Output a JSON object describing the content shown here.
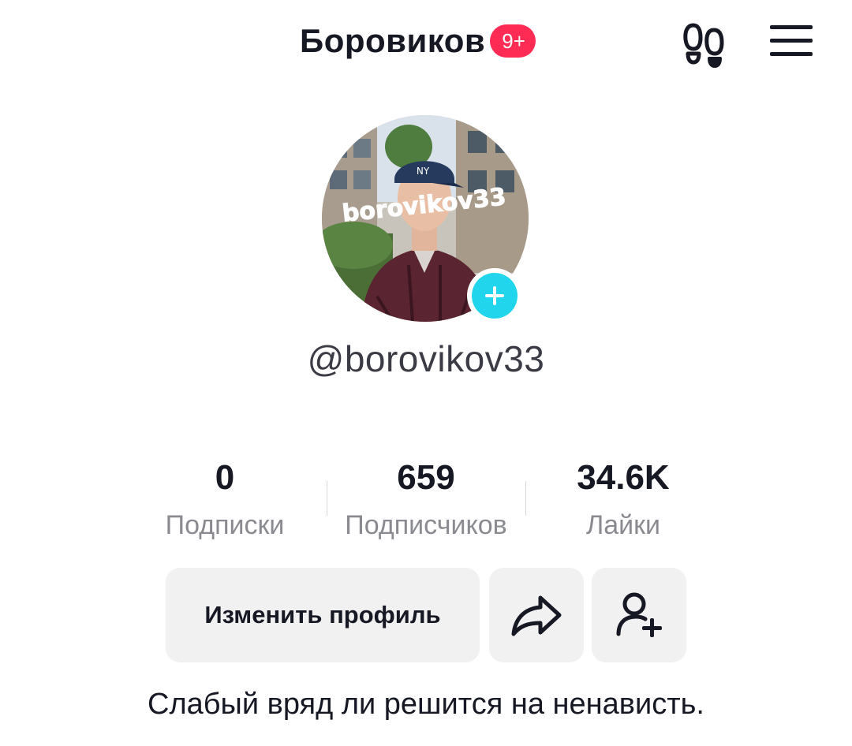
{
  "header": {
    "title": "Боровиков",
    "notification_badge": "9+",
    "footprints_icon": "footprints-icon",
    "menu_icon": "hamburger-menu-icon"
  },
  "profile": {
    "avatar_overlay_text": "borovikov33",
    "add_avatar_icon": "plus-icon",
    "username": "@borovikov33",
    "bio": "Слабый вряд ли решится на ненависть."
  },
  "stats": [
    {
      "value": "0",
      "label": "Подписки"
    },
    {
      "value": "659",
      "label": "Подписчиков"
    },
    {
      "value": "34.6K",
      "label": "Лайки"
    }
  ],
  "actions": {
    "edit_profile_label": "Изменить профиль",
    "share_icon": "share-arrow-icon",
    "add_friend_icon": "add-friend-icon"
  },
  "colors": {
    "accent": "#fe2c55",
    "avatar_add": "#20d5ec",
    "button_bg": "#f1f1f2",
    "secondary_text": "#8a8b91"
  }
}
